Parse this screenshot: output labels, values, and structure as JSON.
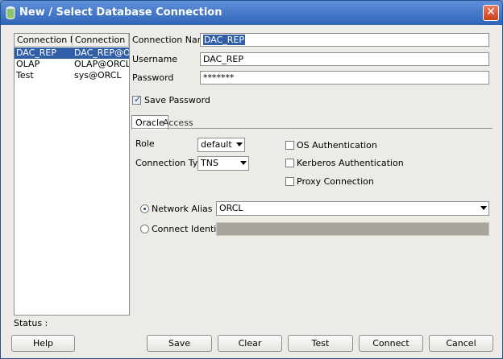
{
  "window": {
    "title": "New / Select Database Connection",
    "close_label": "✕"
  },
  "connections": {
    "headers": [
      "Connection N...",
      "Connection D..."
    ],
    "rows": [
      {
        "name": "DAC_REP",
        "details": "DAC_REP@O..."
      },
      {
        "name": "OLAP",
        "details": "OLAP@ORCL"
      },
      {
        "name": "Test",
        "details": "sys@ORCL"
      }
    ]
  },
  "form": {
    "connection_name_label": "Connection Name",
    "connection_name_value": "DAC_REP",
    "username_label": "Username",
    "username_value": "DAC_REP",
    "password_label": "Password",
    "password_value": "*******",
    "save_password_label": "Save Password",
    "save_password_checked": true
  },
  "tabs": [
    "Oracle",
    "Access"
  ],
  "oracle": {
    "role_label": "Role",
    "role_value": "default",
    "connection_type_label": "Connection Type",
    "connection_type_value": "TNS",
    "options": [
      "OS Authentication",
      "Kerberos Authentication",
      "Proxy Connection"
    ],
    "network_alias_label": "Network Alias",
    "network_alias_value": "ORCL",
    "connect_identifier_label": "Connect Identifier"
  },
  "status_label": "Status :",
  "buttons": {
    "help": "Help",
    "save": "Save",
    "clear": "Clear",
    "test": "Test",
    "connect": "Connect",
    "cancel": "Cancel"
  }
}
